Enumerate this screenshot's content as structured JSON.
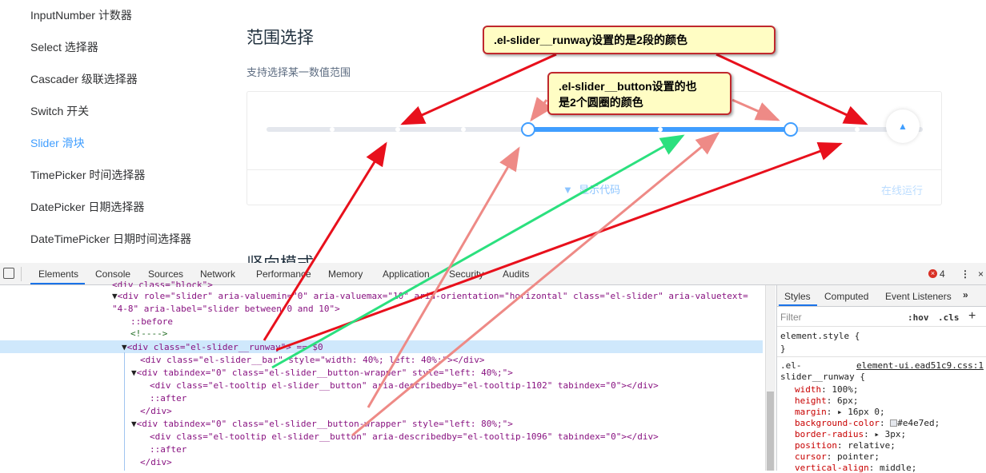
{
  "sidebar": {
    "items": [
      {
        "label": "InputNumber 计数器"
      },
      {
        "label": "Select 选择器"
      },
      {
        "label": "Cascader 级联选择器"
      },
      {
        "label": "Switch 开关"
      },
      {
        "label": "Slider 滑块"
      },
      {
        "label": "TimePicker 时间选择器"
      },
      {
        "label": "DatePicker 日期选择器"
      },
      {
        "label": "DateTimePicker 日期时间选择器"
      }
    ],
    "active_index": 4
  },
  "demo": {
    "title": "范围选择",
    "description": "支持选择某一数值范围",
    "slider": {
      "min": 0,
      "max": 10,
      "range": [
        4,
        8
      ]
    },
    "show_code": "显示代码",
    "run_online": "在线运行",
    "next_title": "竖向模式"
  },
  "callouts": {
    "runway": ".el-slider__runway设置的是2段的颜色",
    "button_line1": ".el-slider__button设置的也",
    "button_line2": "是2个圆圈的颜色"
  },
  "devtools": {
    "tabs": [
      "Elements",
      "Console",
      "Sources",
      "Network",
      "Performance",
      "Memory",
      "Application",
      "Security",
      "Audits"
    ],
    "error_count": "4",
    "dom_lines": {
      "l0": "<div class=\"block\">",
      "l1a": "<div role=\"slider\" aria-valuemin=\"0\" aria-valuemax=\"10\" aria-orientation=\"horizontal\" class=\"el-slider\" aria-valuetext=",
      "l1b": "\"4-8\" aria-label=\"slider between 0 and 10\">",
      "l2": "::before",
      "l3": "<!---->",
      "l4": "<div class=\"el-slider__runway\"> == $0",
      "l5": "<div class=\"el-slider__bar\" style=\"width: 40%; left: 40%;\"></div>",
      "l6": "<div tabindex=\"0\" class=\"el-slider__button-wrapper\" style=\"left: 40%;\">",
      "l7": "<div class=\"el-tooltip el-slider__button\" aria-describedby=\"el-tooltip-1102\" tabindex=\"0\"></div>",
      "l8": "::after",
      "l9": "</div>",
      "l10": "<div tabindex=\"0\" class=\"el-slider__button-wrapper\" style=\"left: 80%;\">",
      "l11": "<div class=\"el-tooltip el-slider__button\" aria-describedby=\"el-tooltip-1096\" tabindex=\"0\"></div>",
      "l12": "::after",
      "l13": "</div>"
    },
    "styles": {
      "tabs": [
        "Styles",
        "Computed",
        "Event Listeners"
      ],
      "filter_placeholder": "Filter",
      "hov": ":hov",
      "cls": ".cls",
      "element_style": "element.style {",
      "close_brace": "}",
      "rule_selector_a": ".el-",
      "rule_selector_b": "slider__runway {",
      "rule_source": "element-ui.ead51c9.css:1",
      "props": [
        {
          "name": "width",
          "value": "100%;"
        },
        {
          "name": "height",
          "value": "6px;"
        },
        {
          "name": "margin",
          "value": "▸ 16px 0;"
        },
        {
          "name": "background-color",
          "value": "#e4e7ed;",
          "swatch": "#e4e7ed"
        },
        {
          "name": "border-radius",
          "value": "▸ 3px;"
        },
        {
          "name": "position",
          "value": "relative;"
        },
        {
          "name": "cursor",
          "value": "pointer;"
        },
        {
          "name": "vertical-align",
          "value": "middle;"
        }
      ]
    }
  },
  "colors": {
    "accent": "#409eff",
    "runway": "#e4e7ed",
    "callout_bg": "#fffdc4",
    "callout_border": "#c0282d",
    "arrow_red": "#e8101c",
    "arrow_pink": "#ee8a86",
    "arrow_green": "#2be07e"
  }
}
